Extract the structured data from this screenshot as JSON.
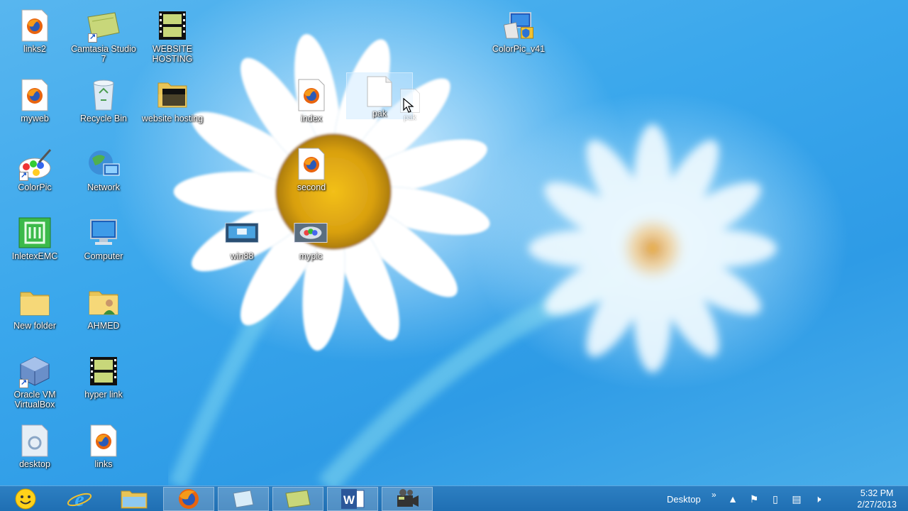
{
  "desktop_icons": [
    {
      "label": "links2"
    },
    {
      "label": "Camtasia Studio 7"
    },
    {
      "label": "WEBSITE HOSTING"
    },
    {
      "label": "ColorPic_v41"
    },
    {
      "label": "myweb"
    },
    {
      "label": "Recycle Bin"
    },
    {
      "label": "website hosting"
    },
    {
      "label": "index"
    },
    {
      "label": "pak"
    },
    {
      "label": "ColorPic"
    },
    {
      "label": "Network"
    },
    {
      "label": "second"
    },
    {
      "label": "InletexEMC"
    },
    {
      "label": "Computer"
    },
    {
      "label": "win88"
    },
    {
      "label": "mypic"
    },
    {
      "label": "New folder"
    },
    {
      "label": "AHMED"
    },
    {
      "label": "Oracle VM VirtualBox"
    },
    {
      "label": "hyper link"
    },
    {
      "label": "desktop"
    },
    {
      "label": "links"
    }
  ],
  "drag_ghost": {
    "label": "pak"
  },
  "taskbar": {
    "desktop_label": "Desktop",
    "overflow_label": "»",
    "time": "5:32 PM",
    "date": "2/27/2013"
  },
  "colors": {
    "taskbar": "#1f6fb3",
    "desktop": "#3aa7ec"
  }
}
